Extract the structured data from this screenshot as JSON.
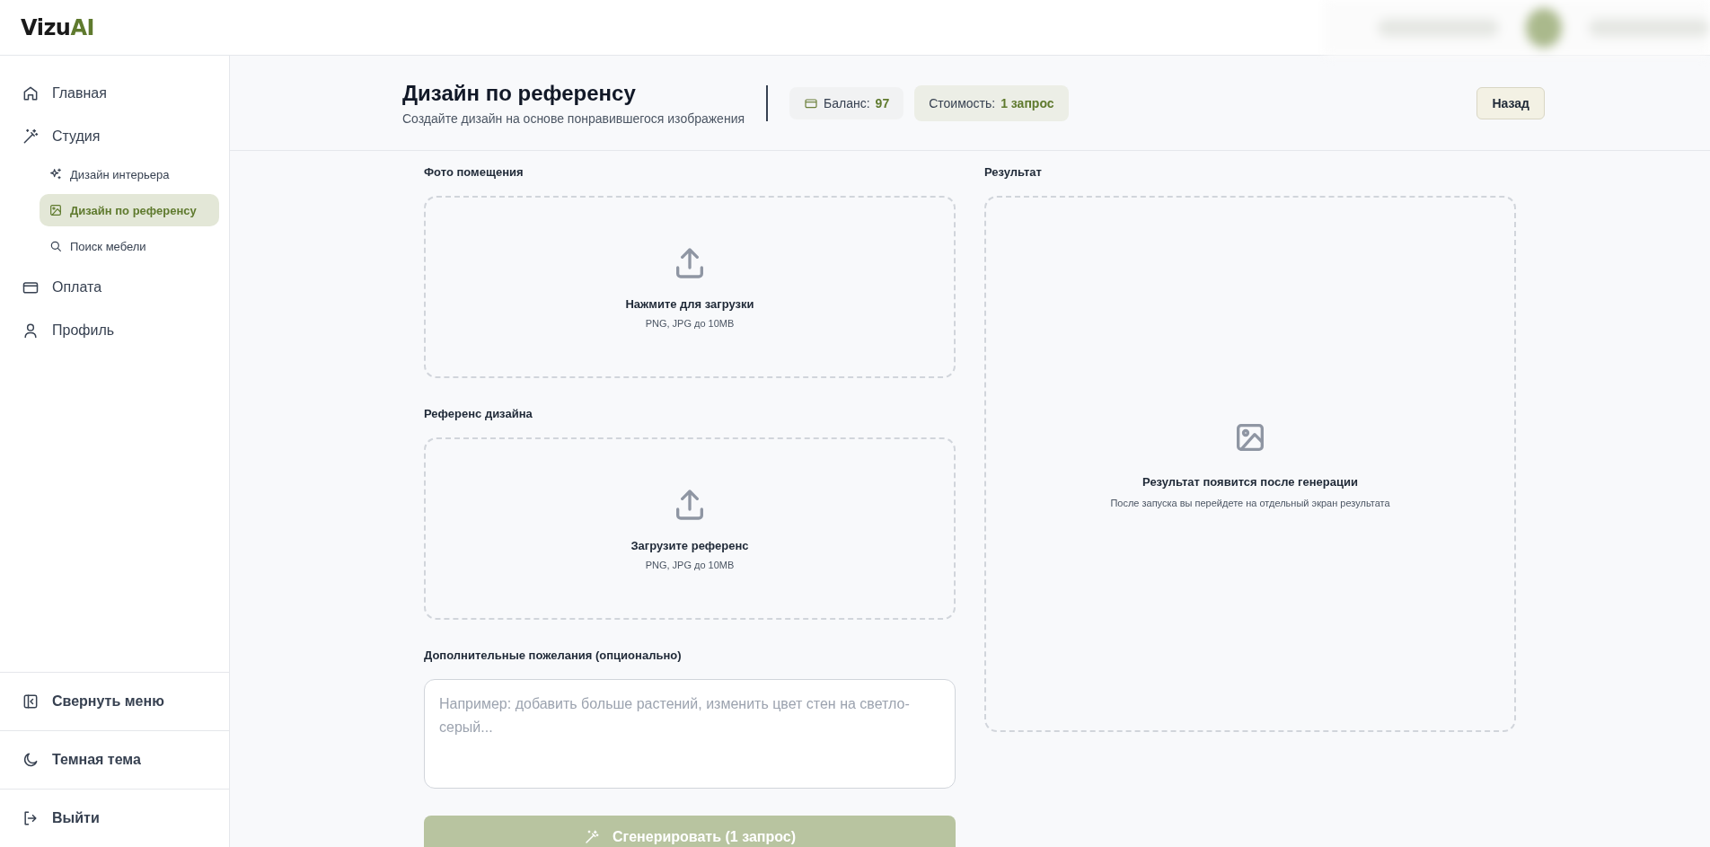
{
  "logo": {
    "text": "Vizu",
    "accent": "AI"
  },
  "sidebar": {
    "items": [
      {
        "label": "Главная",
        "selected": false
      },
      {
        "label": "Студия",
        "selected": false,
        "children": [
          {
            "label": "Дизайн интерьера",
            "selected": false
          },
          {
            "label": "Дизайн по референсу",
            "selected": true
          },
          {
            "label": "Поиск мебели",
            "selected": false
          }
        ]
      },
      {
        "label": "Оплата",
        "selected": false
      },
      {
        "label": "Профиль",
        "selected": false
      }
    ],
    "footer": [
      {
        "label": "Свернуть меню"
      },
      {
        "label": "Темная тема"
      },
      {
        "label": "Выйти"
      }
    ]
  },
  "header": {
    "title": "Дизайн по референсу",
    "subtitle": "Создайте дизайн на основе понравившегося изображения",
    "balance_label": "Баланс:",
    "balance_value": "97",
    "cost_label": "Стоимость:",
    "cost_value": "1 запрос",
    "back_button": "Назад"
  },
  "uploads": [
    {
      "label": "Фото помещения",
      "title": "Нажмите для загрузки",
      "hint": "PNG, JPG до 10MB"
    },
    {
      "label": "Референс дизайна",
      "title": "Загрузите референс",
      "hint": "PNG, JPG до 10MB"
    }
  ],
  "wishes": {
    "label": "Дополнительные пожелания (опционально)",
    "placeholder": "Например: добавить больше растений, изменить цвет стен на светло-серый..."
  },
  "generate_button": {
    "label": "Сгенерировать (1 запрос)",
    "disabled": true
  },
  "result": {
    "label": "Результат",
    "title": "Результат появится после генерации",
    "hint": "После запуска вы перейдете на отдельный экран результата"
  }
}
